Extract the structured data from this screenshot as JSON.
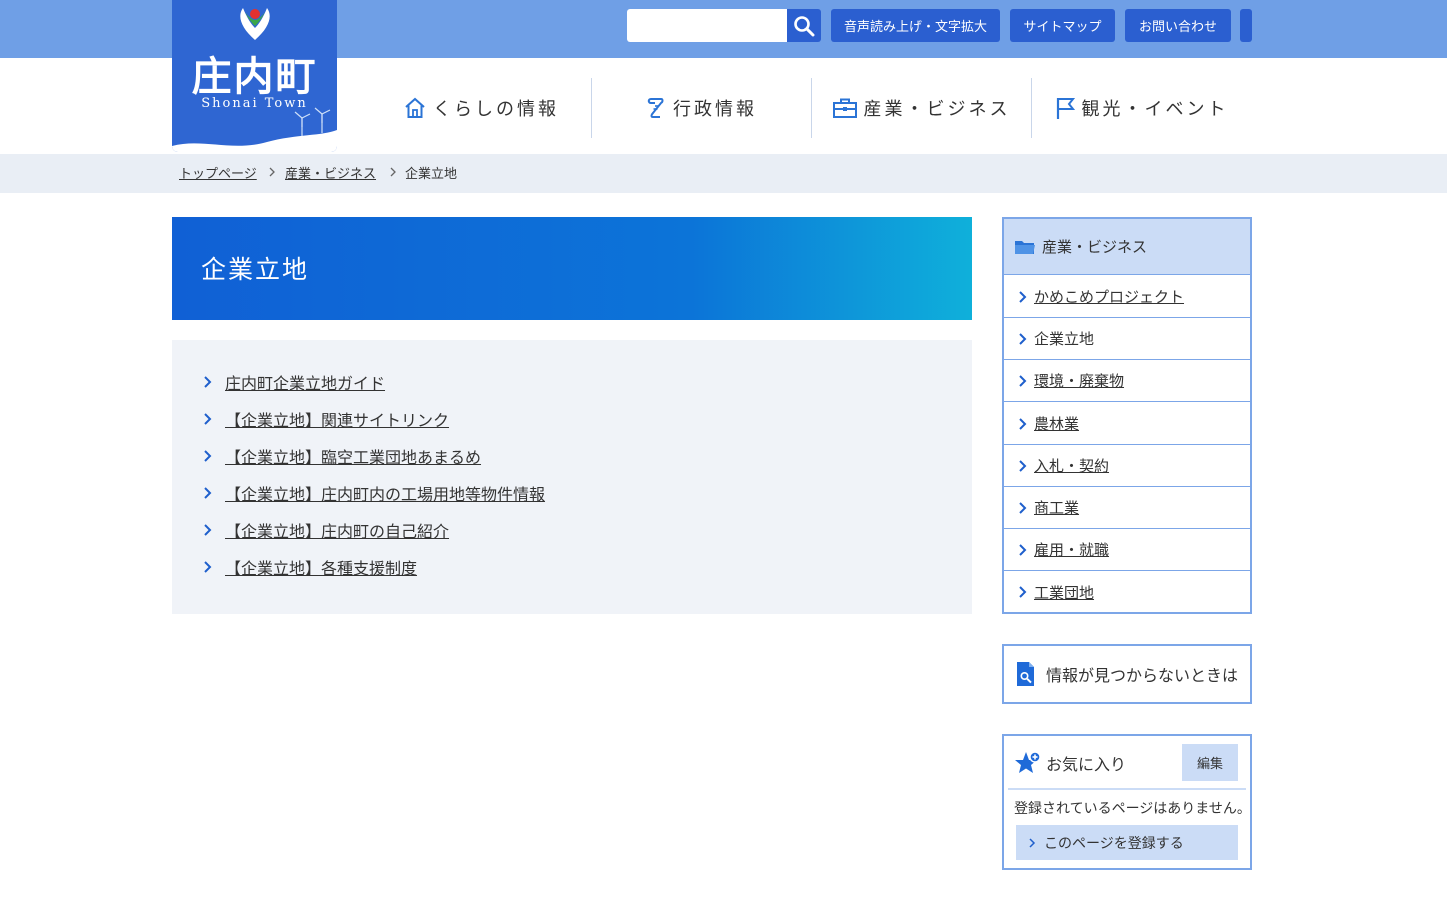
{
  "header": {
    "logo": {
      "title": "庄内町",
      "subtitle": "Shonai Town"
    },
    "search": {
      "placeholder": "",
      "button_icon": "search-icon"
    },
    "buttons": {
      "voice": "音声読み上げ・文字拡大",
      "sitemap": "サイトマップ",
      "contact": "お問い合わせ"
    },
    "colors": {
      "topbar": "#6f9fe6",
      "button": "#2b5fd0",
      "logo_bg": "#2f66d2"
    }
  },
  "gnav": {
    "items": [
      {
        "label": "くらしの情報",
        "icon": "house-icon"
      },
      {
        "label": "行政情報",
        "icon": "scroll-icon"
      },
      {
        "label": "産業・ビジネス",
        "icon": "toolbox-icon"
      },
      {
        "label": "観光・イベント",
        "icon": "flag-icon"
      }
    ]
  },
  "breadcrumb": {
    "items": [
      "トップページ",
      "産業・ビジネス",
      "企業立地"
    ]
  },
  "page": {
    "title": "企業立地",
    "links": [
      "庄内町企業立地ガイド",
      "【企業立地】関連サイトリンク",
      "【企業立地】臨空工業団地あまるめ",
      "【企業立地】庄内町内の工場用地等物件情報",
      "【企業立地】庄内町の自己紹介",
      "【企業立地】各種支援制度"
    ]
  },
  "sidebar": {
    "heading": "産業・ビジネス",
    "heading_icon": "folder-icon",
    "items": [
      {
        "label": "かめこめプロジェクト",
        "link": true
      },
      {
        "label": "企業立地",
        "link": false
      },
      {
        "label": "環境・廃棄物",
        "link": true
      },
      {
        "label": "農林業",
        "link": true
      },
      {
        "label": "入札・契約",
        "link": true
      },
      {
        "label": "商工業",
        "link": true
      },
      {
        "label": "雇用・就職",
        "link": true
      },
      {
        "label": "工業団地",
        "link": true
      }
    ],
    "not_found": "情報が見つからないときは",
    "favorites": {
      "title": "お気に入り",
      "edit": "編集",
      "empty_message": "登録されているページはありません。",
      "register": "このページを登録する"
    }
  }
}
